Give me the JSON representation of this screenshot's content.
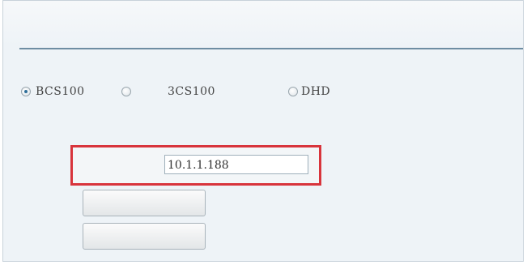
{
  "radio_options": [
    {
      "label": "BCS100",
      "checked": true
    },
    {
      "label": "",
      "checked": false
    },
    {
      "label": "3CS100",
      "checked": false
    },
    {
      "label": "DHD",
      "checked": false
    }
  ],
  "ip_field": {
    "value": "10.1.1.188"
  },
  "buttons": [
    {
      "label": ""
    },
    {
      "label": ""
    }
  ],
  "colors": {
    "highlight_border": "#d8343c",
    "separator": "#6e8da2",
    "background": "#eef3f7"
  }
}
